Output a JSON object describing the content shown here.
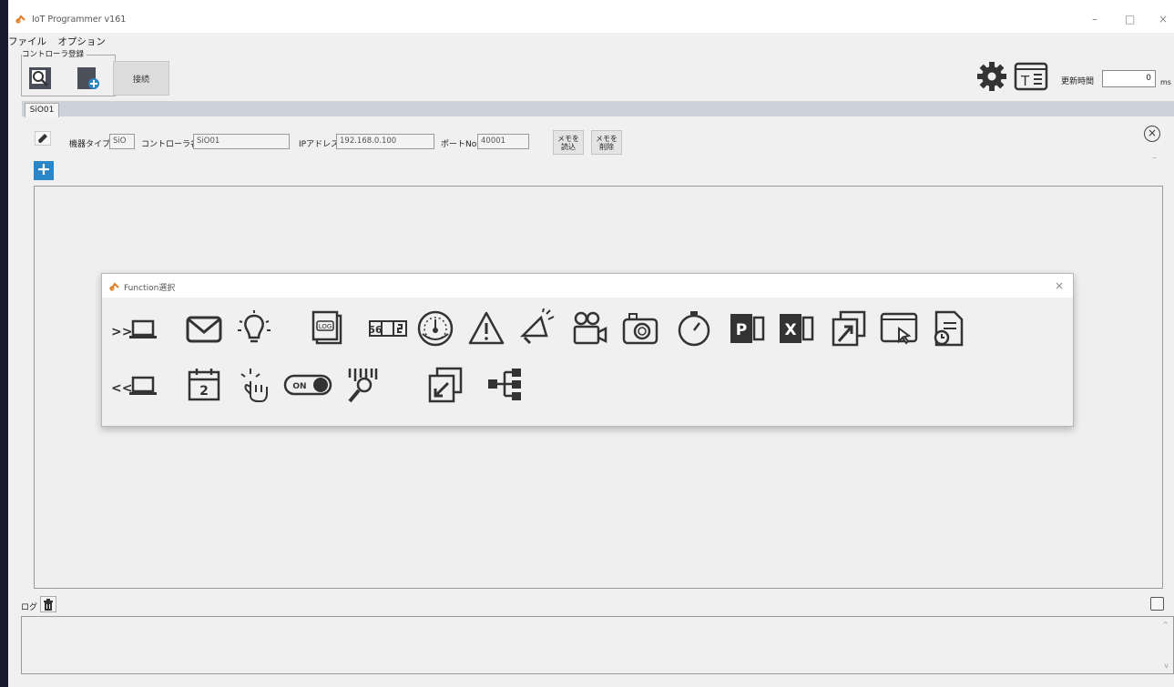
{
  "window": {
    "title": "IoT Programmer v161",
    "minimize": "–",
    "maximize": "□",
    "close": "×"
  },
  "menu": {
    "items": [
      "ファイル",
      "オプション"
    ]
  },
  "controller_group": {
    "label": "コントローラ登録",
    "connect_label": "接続"
  },
  "toolbar_right": {
    "update_label": "更新時間",
    "update_value": "0",
    "update_unit": "ms"
  },
  "tabs": [
    {
      "label": "SiO01"
    }
  ],
  "controller": {
    "type_label": "機器タイプ",
    "type_value": "SiO",
    "name_label": "コントローラ名",
    "name_value": "SiO01",
    "ip_label": "IPアドレス",
    "ip_value": "192.168.0.100",
    "port_label": "ポートNo.",
    "port_value": "40001",
    "memo_read_label": [
      "メモを",
      "読込"
    ],
    "memo_delete_label": [
      "メモを",
      "削除"
    ]
  },
  "function_dialog": {
    "title": "Function選択",
    "close": "×",
    "row1": [
      "input-pc-icon",
      "mail-icon",
      "lightbulb-icon",
      "log-icon",
      "counter-icon",
      "gauge-icon",
      "warning-icon",
      "announcement-icon",
      "video-camera-icon",
      "camera-icon",
      "timer-icon",
      "powerpoint-icon",
      "excel-icon",
      "window-open-icon",
      "screen-click-icon",
      "document-schedule-icon"
    ],
    "row2": [
      "output-pc-icon",
      "calendar-icon",
      "touch-icon",
      "toggle-icon",
      "barcode-scan-icon",
      "window-return-icon",
      "branch-icon"
    ],
    "input_prefix": ">>",
    "output_prefix": "<<",
    "log_text": "LOG",
    "counter_text": "56",
    "calendar_text": "2",
    "toggle_text": "ON",
    "ppt_text": "P",
    "xls_text": "X"
  },
  "log": {
    "label": "ログ",
    "scroll_up": "^",
    "scroll_down": "v"
  },
  "colors": {
    "accent": "#2a86c6",
    "tabstrip": "#cdd1d9",
    "icon": "#333333"
  }
}
